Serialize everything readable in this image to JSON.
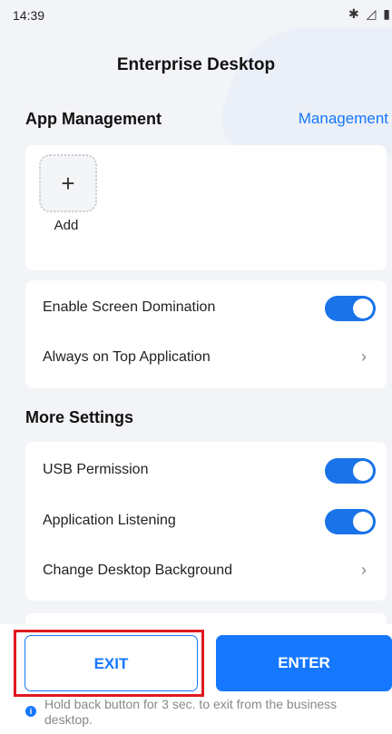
{
  "status": {
    "time": "14:39",
    "icons": "✱ ◿ ▮"
  },
  "header": {
    "title": "Enterprise Desktop"
  },
  "app_management": {
    "title": "App Management",
    "link": "Management",
    "add_icon": "+",
    "add_label": "Add"
  },
  "screen_settings": [
    {
      "label": "Enable Screen Domination",
      "control": "toggle",
      "on": true
    },
    {
      "label": "Always on Top Application",
      "control": "chevron"
    }
  ],
  "more_settings": {
    "title": "More Settings",
    "items": [
      {
        "label": "USB Permission",
        "control": "toggle",
        "on": true
      },
      {
        "label": "Application Listening",
        "control": "toggle",
        "on": true
      },
      {
        "label": "Change Desktop Background",
        "control": "chevron"
      }
    ]
  },
  "footer": {
    "exit_label": "EXIT",
    "enter_label": "ENTER",
    "hint": "Hold back button for 3 sec. to exit from the business desktop."
  },
  "icons": {
    "chevron": "›",
    "info": "i"
  },
  "colors": {
    "accent": "#1677ff",
    "highlight": "#e0191f",
    "background": "#f2f4f7"
  }
}
